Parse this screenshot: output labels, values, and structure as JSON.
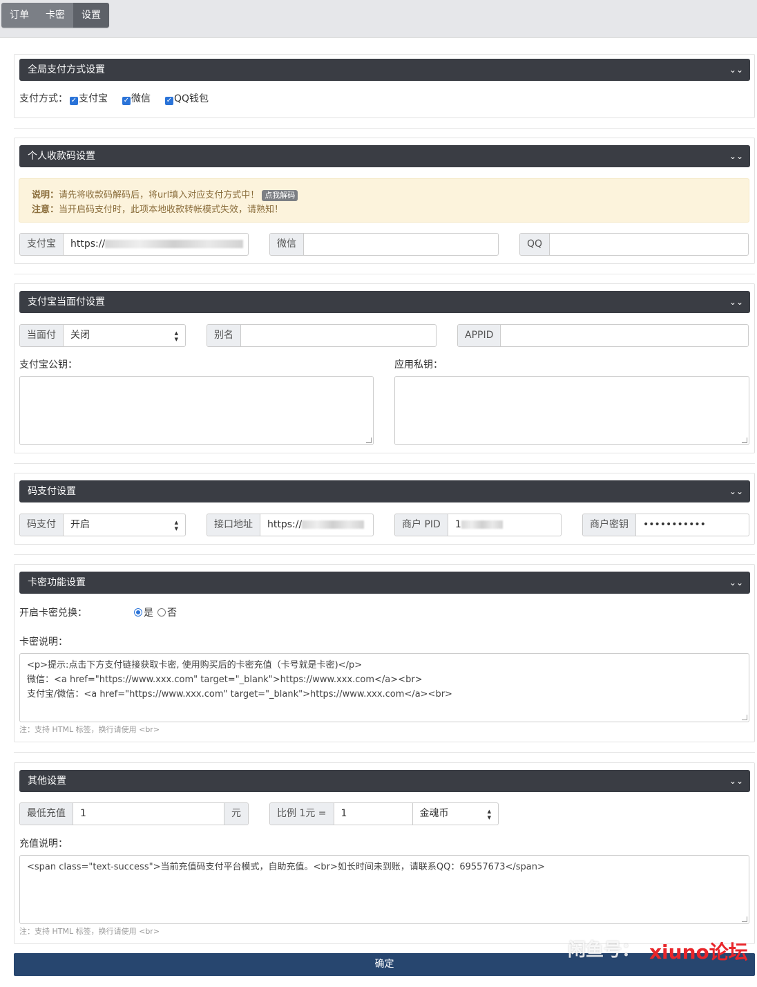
{
  "tabs": [
    {
      "label": "订单"
    },
    {
      "label": "卡密"
    },
    {
      "label": "设置",
      "active": true
    }
  ],
  "global_payment": {
    "title": "全局支付方式设置",
    "field_label": "支付方式：",
    "options": [
      {
        "label": "支付宝",
        "checked": true
      },
      {
        "label": "微信",
        "checked": true
      },
      {
        "label": "QQ钱包",
        "checked": true
      }
    ]
  },
  "personal_qr": {
    "title": "个人收款码设置",
    "alert_line1_label": "说明：",
    "alert_line1_text": "请先将收款码解码后，将url填入对应支付方式中！",
    "alert_badge": "点我解码",
    "alert_line2_label": "注意：",
    "alert_line2_text": "当开启码支付时，此项本地收款转帐模式失效，请熟知！",
    "alipay_label": "支付宝",
    "alipay_value": "https://",
    "wechat_label": "微信",
    "wechat_value": "",
    "qq_label": "QQ",
    "qq_value": ""
  },
  "alipay_f2f": {
    "title": "支付宝当面付设置",
    "f2f_label": "当面付",
    "f2f_value": "关闭",
    "alias_label": "别名",
    "alias_value": "",
    "appid_label": "APPID",
    "appid_value": "",
    "pubkey_label": "支付宝公钥：",
    "privkey_label": "应用私钥："
  },
  "code_pay": {
    "title": "码支付设置",
    "code_label": "码支付",
    "code_value": "开启",
    "api_label": "接口地址",
    "api_value": "https://",
    "pid_label": "商户 PID",
    "pid_value": "1",
    "key_label": "商户密钥",
    "key_value": "•••••••••••"
  },
  "card": {
    "title": "卡密功能设置",
    "enable_label": "开启卡密兑换：",
    "yes_label": "是",
    "no_label": "否",
    "selected": "yes",
    "desc_label": "卡密说明：",
    "desc_value": "<p>提示:点击下方支付链接获取卡密, 使用购买后的卡密充值（卡号就是卡密)</p>\n微信：<a href=\"https://www.xxx.com\" target=\"_blank\">https://www.xxx.com</a><br>\n支付宝/微信：<a href=\"https://www.xxx.com\" target=\"_blank\">https://www.xxx.com</a><br>",
    "note": "注：支持 HTML 标签，换行请使用 <br>"
  },
  "other": {
    "title": "其他设置",
    "min_label": "最低充值",
    "min_value": "1",
    "min_unit": "元",
    "ratio_label": "比例 1元 =",
    "ratio_value": "1",
    "currency_value": "金魂币",
    "desc_label": "充值说明：",
    "desc_value": "<span class=\"text-success\">当前充值码支付平台模式，自助充值。<br>如长时间未到账，请联系QQ：69557673</span>",
    "note": "注：支持 HTML 标签，换行请使用 <br>"
  },
  "submit_label": "确定",
  "watermark": {
    "left_text": "闲鱼号：",
    "right_text": "xiuno论坛",
    "right_color": "#e8262b"
  }
}
